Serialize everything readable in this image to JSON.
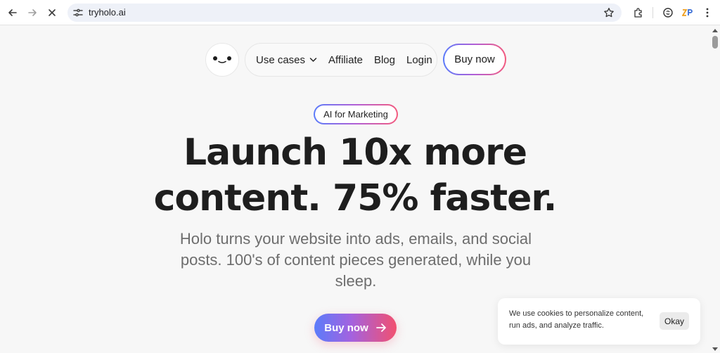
{
  "browser": {
    "url": "tryholo.ai"
  },
  "nav": {
    "logo_face": "•‿•",
    "menu": [
      {
        "label": "Use cases",
        "has_dropdown": true
      },
      {
        "label": "Affiliate"
      },
      {
        "label": "Blog"
      },
      {
        "label": "Login"
      }
    ],
    "buy_label": "Buy now"
  },
  "hero": {
    "badge": "AI for Marketing",
    "headline_line1": "Launch 10x more",
    "headline_line2": "content. 75% faster.",
    "subheadline": "Holo turns your website into ads, emails, and social posts. 100's of content pieces generated, while you sleep.",
    "cta_label": "Buy now"
  },
  "cookie": {
    "text": "We use cookies to personalize content, run ads, and analyze traffic.",
    "okay_label": "Okay"
  },
  "colors": {
    "gradient_start": "#5b7cfa",
    "gradient_mid": "#b15fd6",
    "gradient_end": "#f45b7e",
    "page_bg": "#f7f7f7",
    "omnibox_bg": "#eef1f8"
  }
}
